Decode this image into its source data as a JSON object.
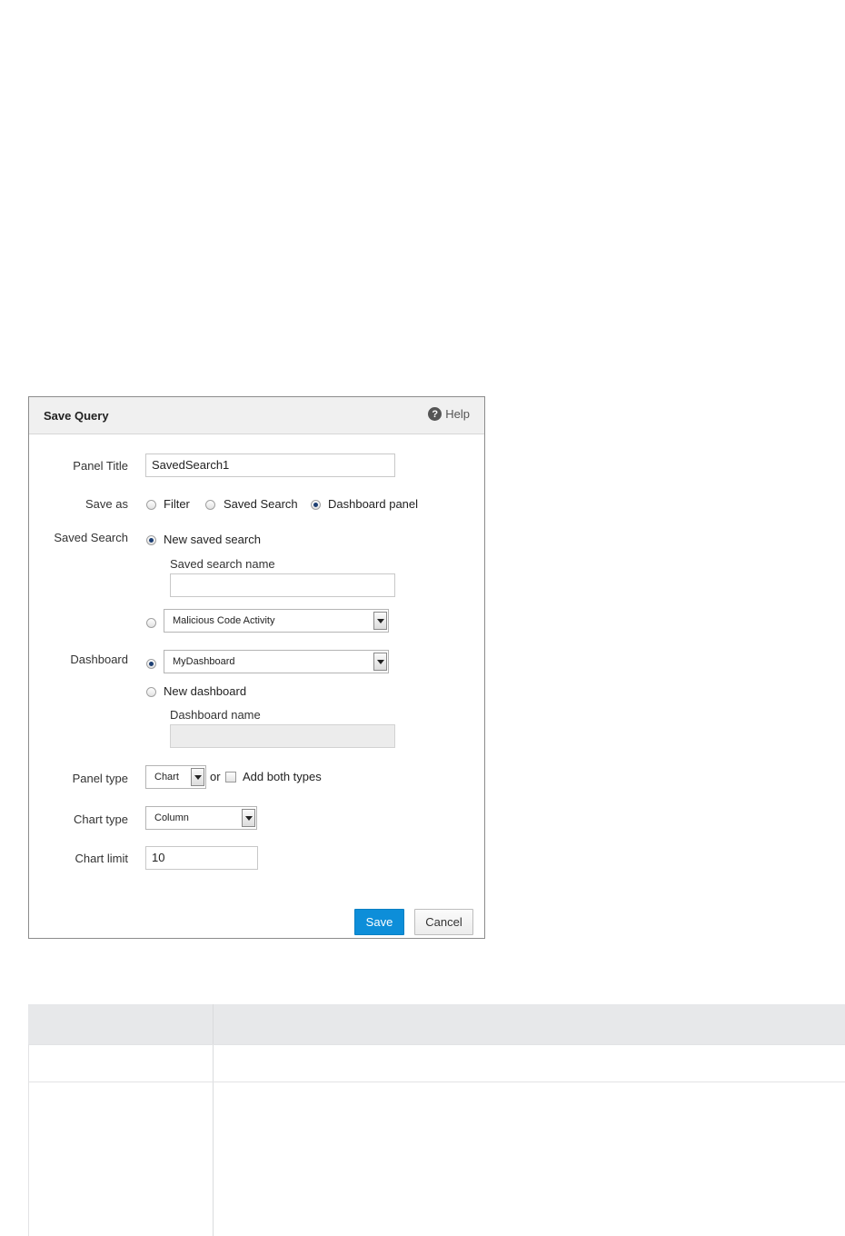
{
  "dialog": {
    "title": "Save Query",
    "help_label": "Help",
    "panel_title": {
      "label": "Panel Title",
      "value": "SavedSearch1"
    },
    "save_as": {
      "label": "Save as",
      "options": [
        "Filter",
        "Saved Search",
        "Dashboard panel"
      ],
      "selected": "Dashboard panel"
    },
    "saved_search": {
      "label": "Saved Search",
      "new_option": "New saved search",
      "name_label": "Saved search name",
      "name_value": "",
      "existing_value": "Malicious Code Activity",
      "selected": "New saved search"
    },
    "dashboard": {
      "label": "Dashboard",
      "existing_value": "MyDashboard",
      "new_option": "New dashboard",
      "name_label": "Dashboard name",
      "name_value": "",
      "selected": "MyDashboard"
    },
    "panel_type": {
      "label": "Panel type",
      "value": "Chart",
      "or_text": "or",
      "add_both_label": "Add both types",
      "add_both_checked": false
    },
    "chart_type": {
      "label": "Chart type",
      "value": "Column"
    },
    "chart_limit": {
      "label": "Chart limit",
      "value": "10"
    },
    "buttons": {
      "save": "Save",
      "cancel": "Cancel"
    }
  }
}
